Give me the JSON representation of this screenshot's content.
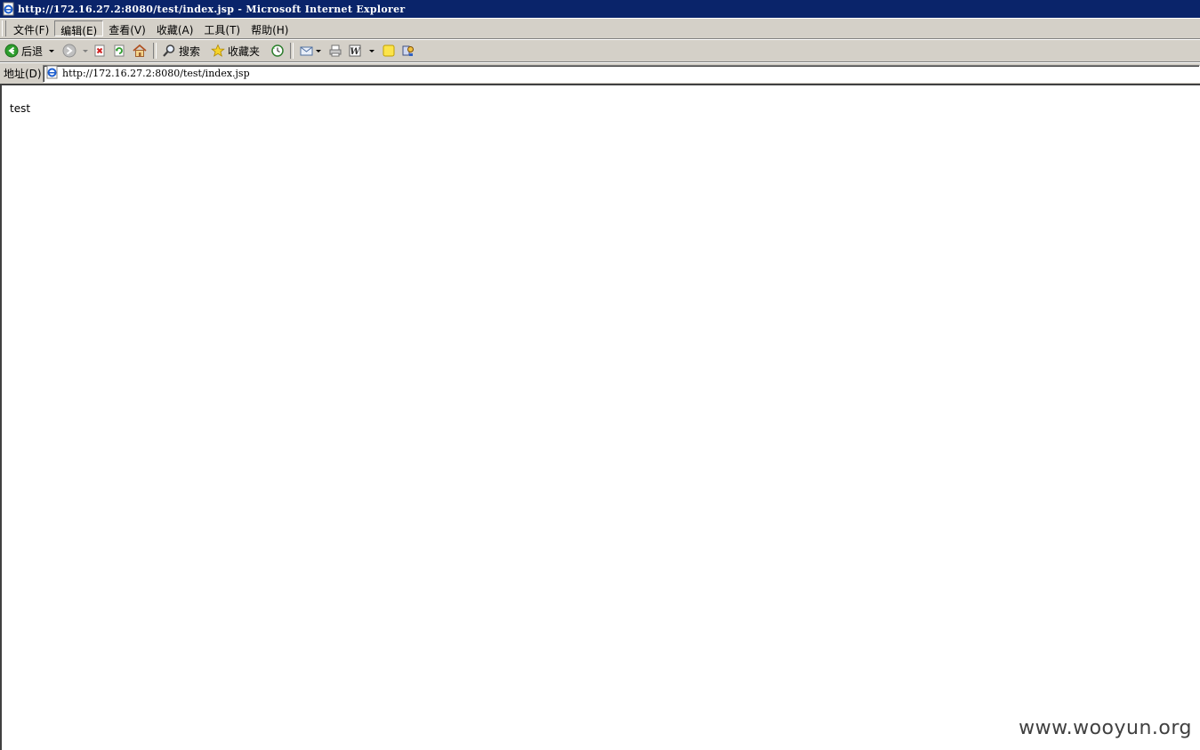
{
  "window": {
    "title": "http://172.16.27.2:8080/test/index.jsp - Microsoft Internet Explorer"
  },
  "menu": {
    "items": [
      {
        "label": "文件(F)"
      },
      {
        "label": "编辑(E)"
      },
      {
        "label": "查看(V)"
      },
      {
        "label": "收藏(A)"
      },
      {
        "label": "工具(T)"
      },
      {
        "label": "帮助(H)"
      }
    ]
  },
  "toolbar": {
    "back_label": "后退",
    "search_label": "搜索",
    "favorites_label": "收藏夹"
  },
  "address": {
    "label": "地址(D)",
    "value": "http://172.16.27.2:8080/test/index.jsp"
  },
  "page": {
    "body_text": "test"
  },
  "watermark": {
    "text": "www.wooyun.org"
  },
  "colors": {
    "titlebar": "#0a246a",
    "chrome": "#d4d0c8"
  }
}
